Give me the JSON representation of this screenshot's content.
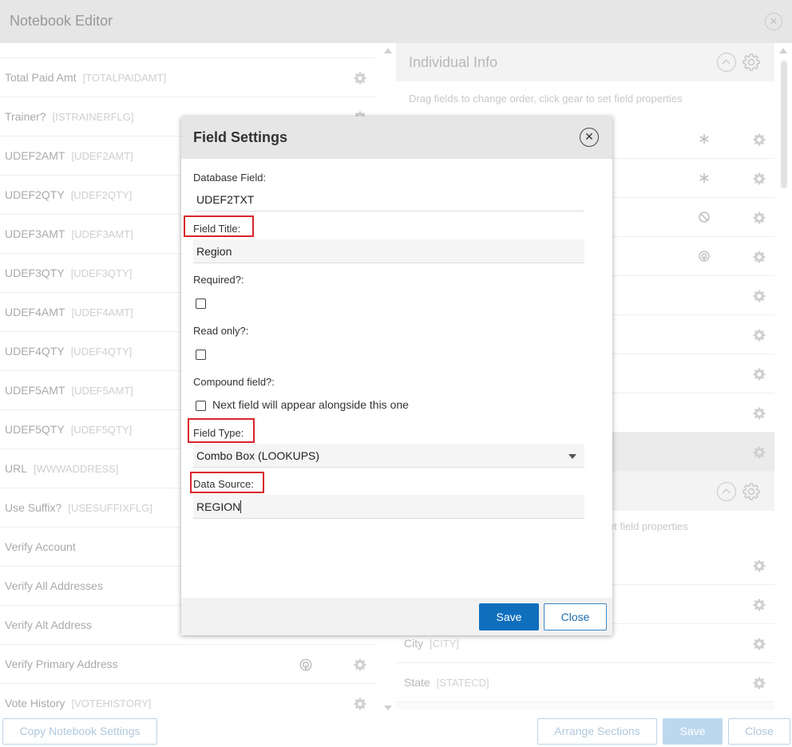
{
  "app": {
    "title": "Notebook Editor",
    "close_glyph": "✕"
  },
  "left_fields": [
    {
      "label": "Total Paid Amt",
      "code": "[TOTALPAIDAMT]",
      "extra_icon": ""
    },
    {
      "label": "Trainer?",
      "code": "[ISTRAINERFLG]",
      "extra_icon": ""
    },
    {
      "label": "UDEF2AMT",
      "code": "[UDEF2AMT]",
      "extra_icon": ""
    },
    {
      "label": "UDEF2QTY",
      "code": "[UDEF2QTY]",
      "extra_icon": ""
    },
    {
      "label": "UDEF3AMT",
      "code": "[UDEF3AMT]",
      "extra_icon": ""
    },
    {
      "label": "UDEF3QTY",
      "code": "[UDEF3QTY]",
      "extra_icon": ""
    },
    {
      "label": "UDEF4AMT",
      "code": "[UDEF4AMT]",
      "extra_icon": ""
    },
    {
      "label": "UDEF4QTY",
      "code": "[UDEF4QTY]",
      "extra_icon": ""
    },
    {
      "label": "UDEF5AMT",
      "code": "[UDEF5AMT]",
      "extra_icon": ""
    },
    {
      "label": "UDEF5QTY",
      "code": "[UDEF5QTY]",
      "extra_icon": ""
    },
    {
      "label": "URL",
      "code": "[WWWADDRESS]",
      "extra_icon": ""
    },
    {
      "label": "Use Suffix?",
      "code": "[USESUFFIXFLG]",
      "extra_icon": ""
    },
    {
      "label": "Verify Account",
      "code": "",
      "extra_icon": ""
    },
    {
      "label": "Verify All Addresses",
      "code": "",
      "extra_icon": ""
    },
    {
      "label": "Verify Alt Address",
      "code": "",
      "extra_icon": ""
    },
    {
      "label": "Verify Primary Address",
      "code": "",
      "extra_icon": "fingerprint-icon"
    },
    {
      "label": "Vote History",
      "code": "[VOTEHISTORY]",
      "extra_icon": ""
    }
  ],
  "right_section": {
    "title": "Individual Info",
    "hint": "Drag fields to change order, click gear to set field properties",
    "second_hint": "et field properties",
    "rows": [
      {
        "label": "City",
        "code": "[CITY]"
      },
      {
        "label": "State",
        "code": "[STATECD]"
      }
    ]
  },
  "footer": {
    "copy_label": "Copy Notebook Settings",
    "arrange_label": "Arrange Sections",
    "save_label": "Save",
    "close_label": "Close"
  },
  "dialog": {
    "title": "Field Settings",
    "database_field_label": "Database Field:",
    "database_field_value": "UDEF2TXT",
    "field_title_label": "Field Title:",
    "field_title_value": "Region",
    "required_label": "Required?:",
    "required_checked": false,
    "read_only_label": "Read only?:",
    "read_only_checked": false,
    "compound_label": "Compound field?:",
    "compound_checkbox_text": "Next field will appear alongside this one",
    "compound_checked": false,
    "field_type_label": "Field Type:",
    "field_type_value": "Combo Box (LOOKUPS)",
    "data_source_label": "Data Source:",
    "data_source_value": "REGION",
    "save_label": "Save",
    "close_label": "Close",
    "close_glyph": "✕",
    "highlight_color": "#d9242b",
    "primary_color": "#0f6fbd"
  }
}
